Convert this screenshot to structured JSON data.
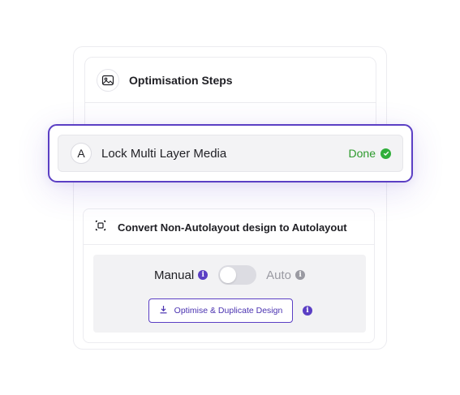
{
  "steps_panel": {
    "title": "Optimisation Steps",
    "icon": "image-optimise-icon"
  },
  "active_step": {
    "letter": "A",
    "label": "Lock Multi Layer Media",
    "status": "Done",
    "status_icon": "check-circle-icon",
    "status_color": "#2d9a2d",
    "highlight_color": "#5b3fc4"
  },
  "autolayout": {
    "title": "Convert Non-Autolayout design to Autolayout",
    "icon": "autolayout-icon",
    "mode": {
      "manual_label": "Manual",
      "auto_label": "Auto",
      "selected": "Manual"
    },
    "action_button": {
      "label": "Optimise & Duplicate Design",
      "icon": "download-icon"
    }
  },
  "colors": {
    "accent": "#5b3fc4",
    "success": "#2fae3a",
    "muted": "#9a9aa2"
  }
}
